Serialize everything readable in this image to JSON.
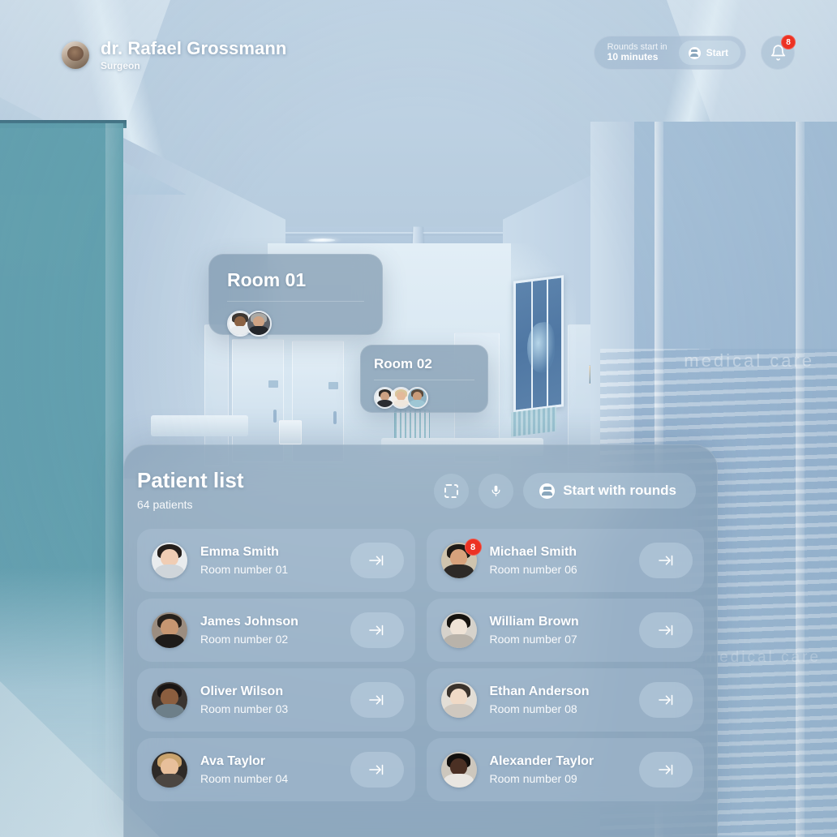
{
  "header": {
    "doctor_name": "dr. Rafael Grossmann",
    "doctor_role": "Surgeon",
    "avatar_icon": "user-avatar",
    "rounds": {
      "label": "Rounds start in",
      "value": "10 minutes",
      "start_label": "Start",
      "start_icon": "people-icon"
    },
    "notifications": {
      "icon": "bell-icon",
      "count": "8"
    }
  },
  "rooms": [
    {
      "title": "Room 01",
      "avatars": [
        "avatar-bald-man",
        "avatar-gray-man"
      ]
    },
    {
      "title": "Room 02",
      "avatars": [
        "avatar-young-man",
        "avatar-blonde-woman",
        "avatar-nurse"
      ]
    }
  ],
  "panel": {
    "title": "Patient list",
    "subtitle": "64 patients",
    "actions": {
      "scan_icon": "scan-frame-icon",
      "mic_icon": "microphone-icon",
      "rounds_cta_label": "Start with rounds",
      "rounds_cta_icon": "people-icon"
    },
    "enter_icon": "arrow-enter-icon",
    "patients": [
      {
        "name": "Emma Smith",
        "room": "Room number 01",
        "badge": null,
        "avatar": "avatar-dark-hair-woman"
      },
      {
        "name": "Michael Smith",
        "room": "Room number 06",
        "badge": "8",
        "avatar": "avatar-man-floral"
      },
      {
        "name": "James Johnson",
        "room": "Room number 02",
        "badge": null,
        "avatar": "avatar-man-dark-jacket"
      },
      {
        "name": "William Brown",
        "room": "Room number 07",
        "badge": null,
        "avatar": "avatar-curly-woman"
      },
      {
        "name": "Oliver Wilson",
        "room": "Room number 03",
        "badge": null,
        "avatar": "avatar-curly-man"
      },
      {
        "name": "Ethan Anderson",
        "room": "Room number 08",
        "badge": null,
        "avatar": "avatar-young-boy"
      },
      {
        "name": "Ava Taylor",
        "room": "Room number 04",
        "badge": null,
        "avatar": "avatar-blonde-smiling"
      },
      {
        "name": "Alexander Taylor",
        "room": "Room number 09",
        "badge": null,
        "avatar": "avatar-smiling-man"
      }
    ]
  },
  "scene": {
    "glass_text_1": "medical care",
    "glass_text_2": "medical care",
    "colors": {
      "teal_glass": "#5ea0ad",
      "wall_blue": "#b3c9dc",
      "badge_red": "#ec3223",
      "panel_glass": "rgba(124,150,173,0.60)"
    }
  }
}
